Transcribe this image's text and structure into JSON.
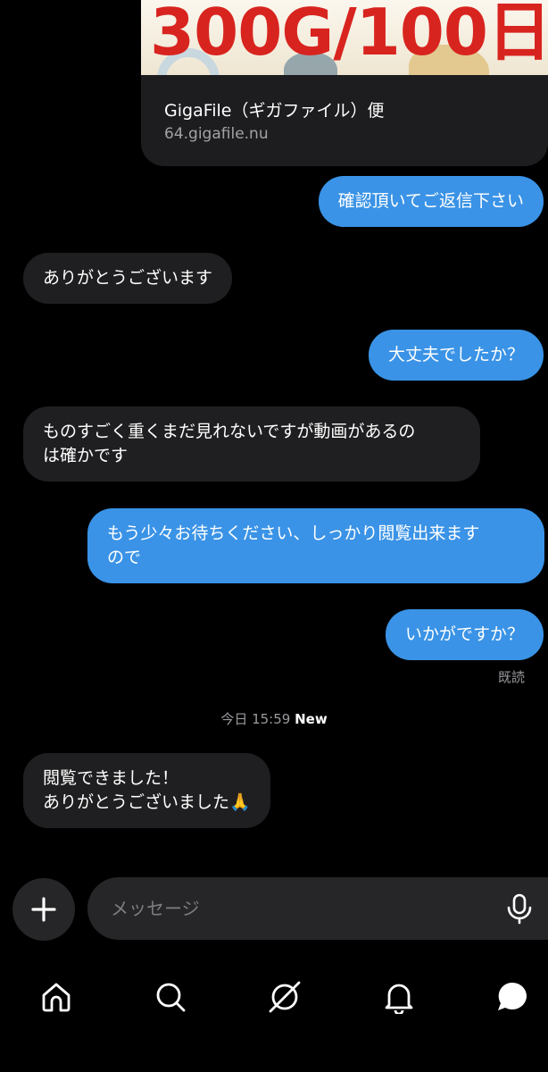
{
  "link_preview": {
    "thumbnail_text": "300G/100日",
    "title": "GigaFile（ギガファイル）便",
    "url": "64.gigafile.nu"
  },
  "messages": [
    {
      "direction": "out",
      "text": "確認頂いてご返信下さい"
    },
    {
      "direction": "in",
      "text": "ありがとうございます"
    },
    {
      "direction": "out",
      "text": "大丈夫でしたか？"
    },
    {
      "direction": "in",
      "lines": [
        "ものすごく重くまだ見れないですが動画があるの",
        "は確かです"
      ]
    },
    {
      "direction": "out",
      "lines": [
        "もう少々お待ちください、しっかり閲覧出来ます",
        "ので"
      ]
    },
    {
      "direction": "out",
      "text": "いかがですか？"
    }
  ],
  "read_receipt": "既読",
  "divider": {
    "date": "今日 15:59",
    "badge": "New"
  },
  "latest_message": {
    "direction": "in",
    "lines": [
      "閲覧できました！",
      "ありがとうございました🙏"
    ]
  },
  "composer": {
    "placeholder": "メッセージ"
  },
  "tabbar": [
    "home-icon",
    "search-icon",
    "explore-icon",
    "bell-icon",
    "chat-icon"
  ],
  "colors": {
    "outgoing_bubble": "#3a93e6",
    "incoming_bubble": "#1f1f21",
    "background": "#000000"
  }
}
